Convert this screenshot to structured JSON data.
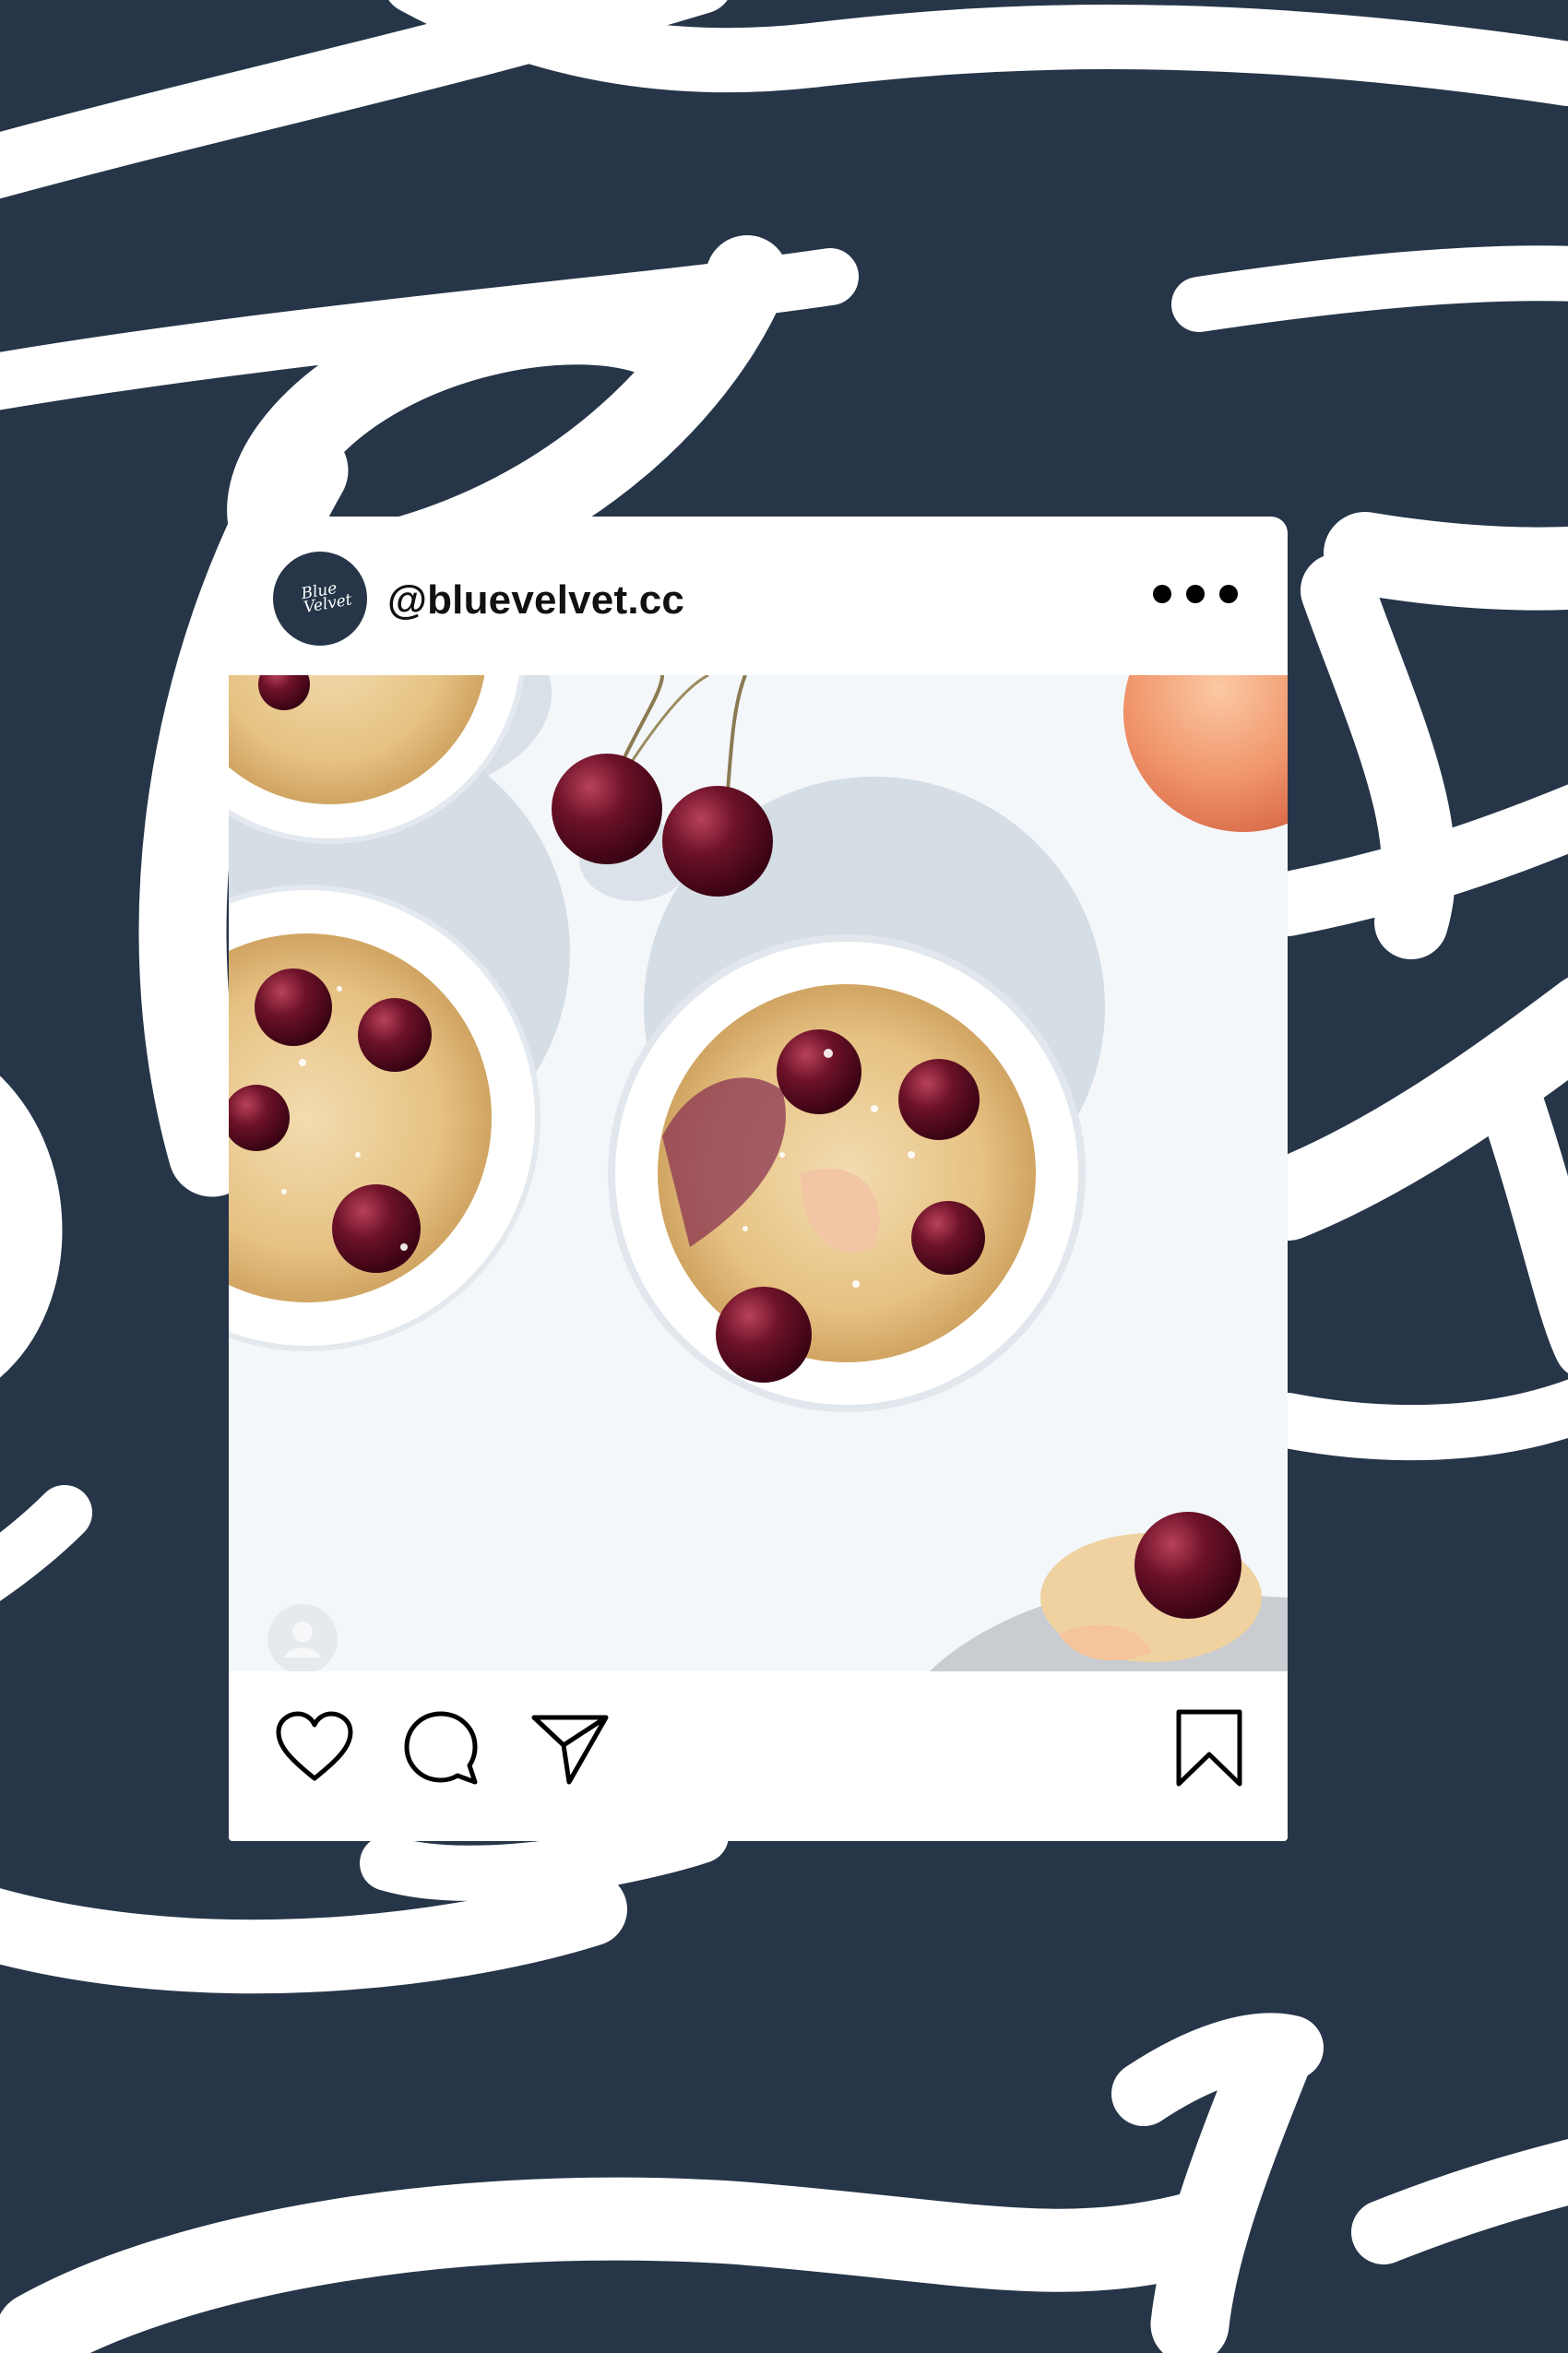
{
  "post": {
    "username": "@bluevelvet.cc",
    "avatar_logo_line1": "Blue",
    "avatar_logo_line2": "Velvet"
  },
  "icons": {
    "more": "more-horizontal-icon",
    "like": "heart-icon",
    "comment": "comment-bubble-icon",
    "share": "send-paper-plane-icon",
    "save": "bookmark-icon",
    "tagged_user": "user-tag-icon"
  },
  "colors": {
    "background": "#263548",
    "script": "#ffffff",
    "card": "#ffffff",
    "cherry": "#5a0f24"
  }
}
